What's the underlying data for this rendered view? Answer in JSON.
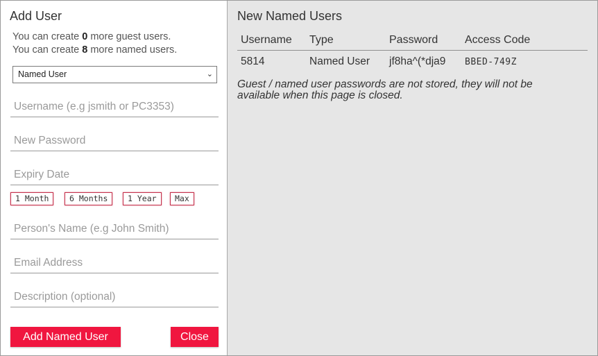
{
  "add_user": {
    "title": "Add User",
    "quota_line1_prefix": "You can create ",
    "quota_line1_count": "0",
    "quota_line1_suffix": " more guest users.",
    "quota_line2_prefix": "You can create ",
    "quota_line2_count": "8",
    "quota_line2_suffix": " more named users.",
    "user_type_select": {
      "value": "Named User",
      "icon": "chevron-down-icon"
    },
    "fields": {
      "username_placeholder": "Username (e.g jsmith or PC3353)",
      "password_placeholder": "New Password",
      "expiry_placeholder": "Expiry Date",
      "person_name_placeholder": "Person's Name (e.g John Smith)",
      "email_placeholder": "Email Address",
      "description_placeholder": "Description (optional)"
    },
    "expiry_presets": [
      "1 Month",
      "6 Months",
      "1 Year",
      "Max"
    ],
    "add_button_label": "Add Named User",
    "close_button_label": "Close",
    "accent_color": "#f0163f"
  },
  "new_users": {
    "title": "New Named Users",
    "columns": [
      "Username",
      "Type",
      "Password",
      "Access Code"
    ],
    "rows": [
      {
        "username": "5814",
        "type": "Named User",
        "password": "jf8ha^(*dja9",
        "access_code": "BBED-749Z"
      }
    ],
    "note": "Guest / named user passwords are not stored, they will not be available when this page is closed."
  }
}
